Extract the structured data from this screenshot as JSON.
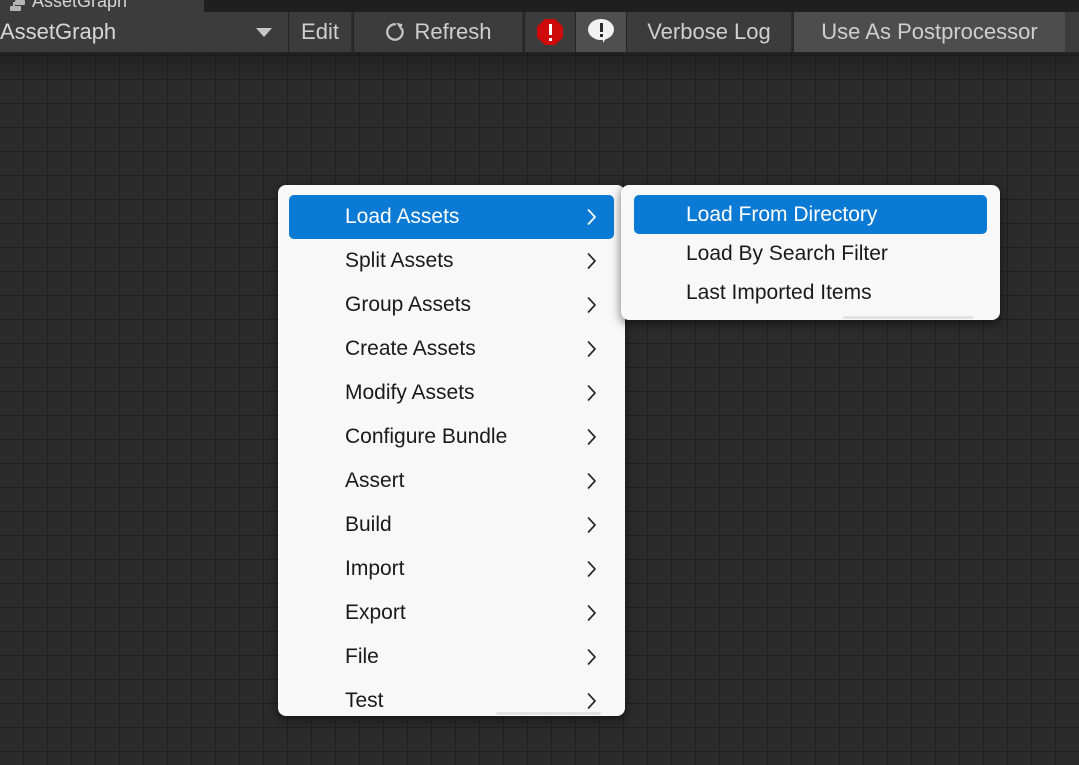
{
  "window": {
    "tab": {
      "label": "AssetGraph",
      "icon": "assetgraph-icon"
    }
  },
  "toolbar": {
    "graph_select": {
      "value": "AssetGraph",
      "dropdown_icon": "chevron-down-icon"
    },
    "edit_label": "Edit",
    "refresh_label": "Refresh",
    "refresh_icon": "refresh-icon",
    "error_icon": "error-octagon-icon",
    "log_icon": "speech-bubble-exclamation-icon",
    "verbose_log_label": "Verbose Log",
    "use_as_postprocessor_label": "Use As Postprocessor"
  },
  "colors": {
    "toolbar_bg": "#3c3c3c",
    "canvas_bg": "#2b2b2b",
    "grid_line": "#202020",
    "menu_bg": "#f8f8f8",
    "menu_highlight": "#0b7ad4",
    "menu_text": "#1a1a1a",
    "menu_text_highlight": "#ffffff",
    "error_red": "#cf0a0a"
  },
  "context_menu": {
    "items": [
      {
        "label": "Load Assets",
        "has_submenu": true,
        "highlighted": true
      },
      {
        "label": "Split Assets",
        "has_submenu": true,
        "highlighted": false
      },
      {
        "label": "Group Assets",
        "has_submenu": true,
        "highlighted": false
      },
      {
        "label": "Create Assets",
        "has_submenu": true,
        "highlighted": false
      },
      {
        "label": "Modify Assets",
        "has_submenu": true,
        "highlighted": false
      },
      {
        "label": "Configure Bundle",
        "has_submenu": true,
        "highlighted": false
      },
      {
        "label": "Assert",
        "has_submenu": true,
        "highlighted": false
      },
      {
        "label": "Build",
        "has_submenu": true,
        "highlighted": false
      },
      {
        "label": "Import",
        "has_submenu": true,
        "highlighted": false
      },
      {
        "label": "Export",
        "has_submenu": true,
        "highlighted": false
      },
      {
        "label": "File",
        "has_submenu": true,
        "highlighted": false
      },
      {
        "label": "Test",
        "has_submenu": true,
        "highlighted": false
      }
    ]
  },
  "submenu": {
    "items": [
      {
        "label": "Load From Directory",
        "highlighted": true
      },
      {
        "label": "Load By Search Filter",
        "highlighted": false
      },
      {
        "label": "Last Imported Items",
        "highlighted": false
      }
    ]
  }
}
